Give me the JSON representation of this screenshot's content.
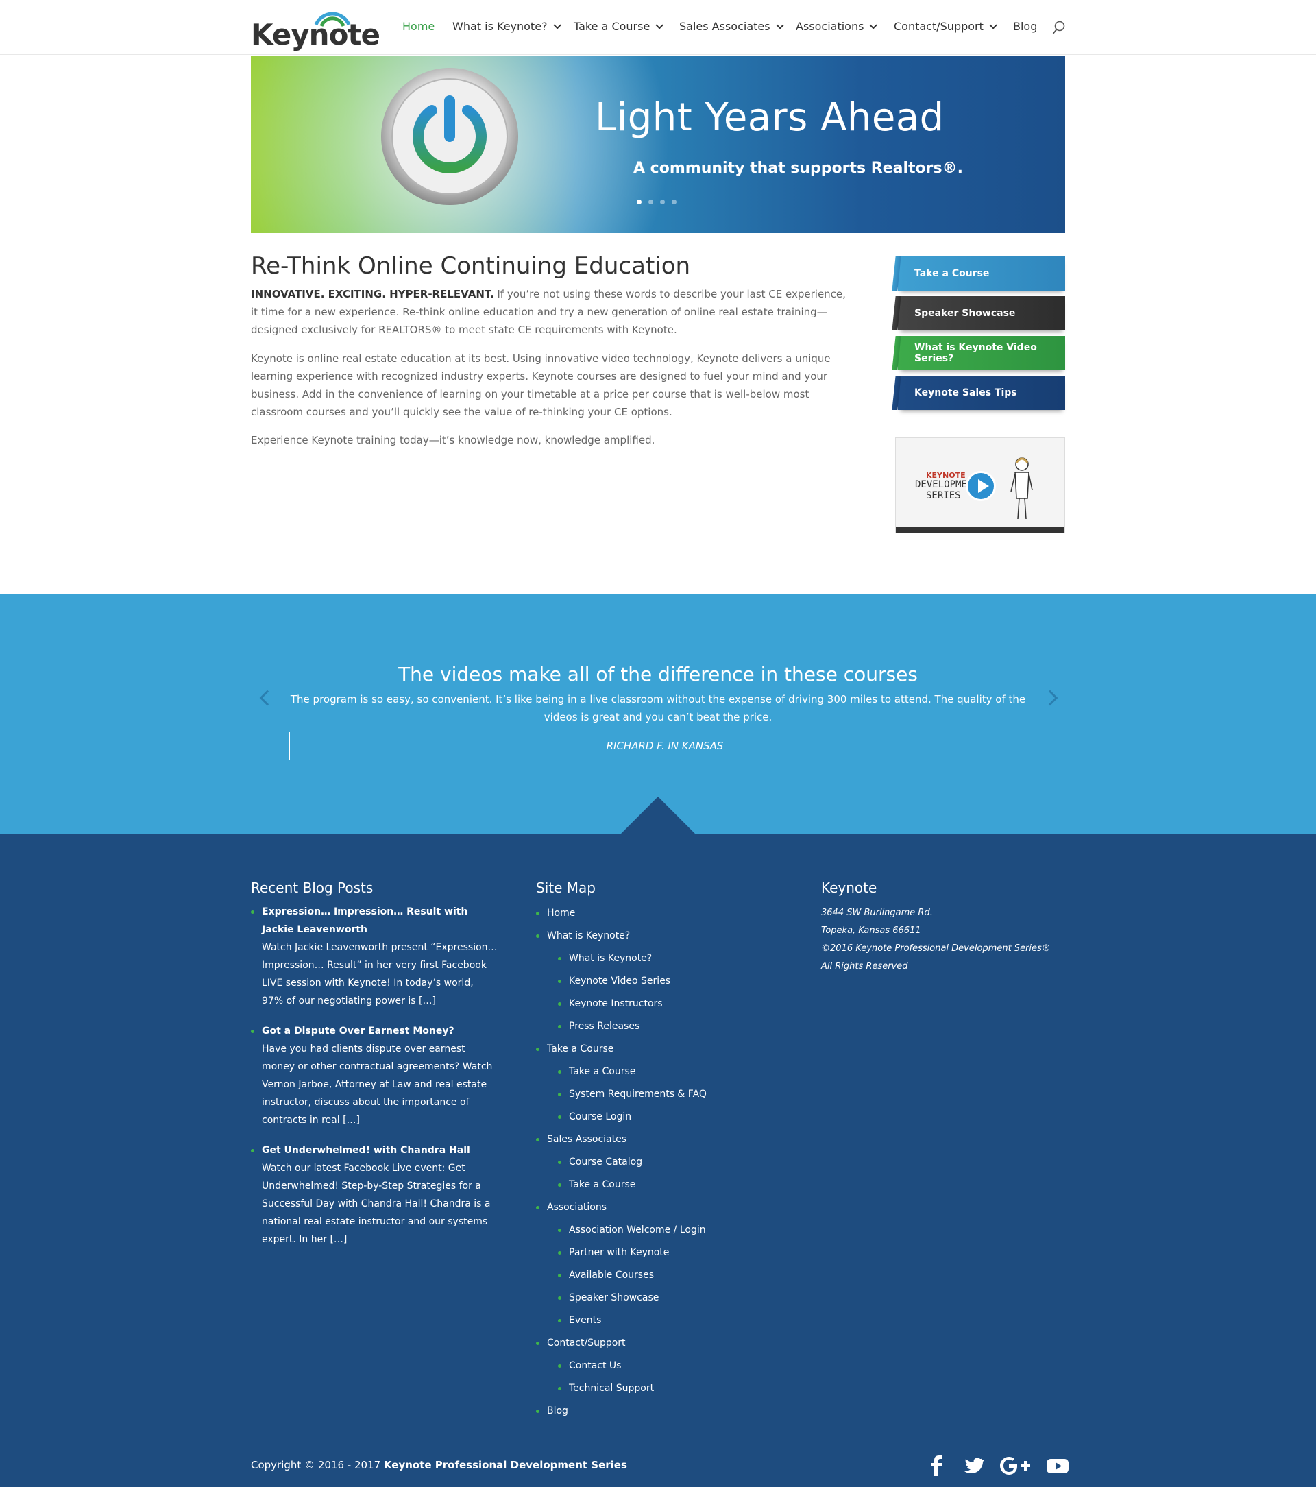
{
  "header": {
    "logo_text": "Keynote",
    "nav": [
      {
        "label": "Home",
        "active": true
      },
      {
        "label": "What is Keynote?",
        "dropdown": true
      },
      {
        "label": "Take a Course",
        "dropdown": true
      },
      {
        "label": "Sales Associates",
        "dropdown": true
      },
      {
        "label": "Associations",
        "dropdown": true
      },
      {
        "label": "Contact/Support",
        "dropdown": true
      },
      {
        "label": "Blog"
      }
    ],
    "search_icon": "search-icon"
  },
  "hero": {
    "title": "Light Years Ahead",
    "subtitle": "A community that supports Realtors®.",
    "slide_count": 4,
    "active_slide": 1
  },
  "main": {
    "title": "Re-Think Online Continuing Education",
    "intro_bold": "INNOVATIVE. EXCITING. HYPER-RELEVANT.",
    "intro_rest": " If you’re not using these words to describe your last CE experience, it time for a new experience. Re-think online education and try a new generation of online real estate training—designed exclusively for REALTORS® to meet state CE requirements with Keynote.",
    "para2": "Keynote is online real estate education at its best. Using innovative video technology, Keynote delivers a unique learning experience with recognized industry experts. Keynote courses are designed to fuel your mind and your business. Add in the convenience of learning on your timetable at a price per course that is well-below most classroom courses and you’ll quickly see the value of re-thinking your CE options.",
    "para3": "Experience Keynote training today—it’s knowledge now, knowledge amplified."
  },
  "sidebar": {
    "buttons": [
      {
        "label": "Take a Course",
        "color": "#3fa0d2"
      },
      {
        "label": "Speaker Showcase",
        "color": "#333333"
      },
      {
        "label": "What is Keynote Video Series?",
        "color": "#3dab4a"
      },
      {
        "label": "Keynote Sales Tips",
        "color": "#1f4c86"
      }
    ],
    "video": {
      "logo_line1": "KEYNOTE",
      "logo_line2": "DEVELOPME",
      "logo_line3": "SERIES"
    }
  },
  "testimonial": {
    "title": "The videos make all of the difference in these courses",
    "body": "The program is so easy, so convenient. It’s like being in a live classroom without the expense of driving 300 miles to attend. The quality of the videos is great and you can’t beat the price.",
    "author": "RICHARD F. IN KANSAS"
  },
  "footer": {
    "blog": {
      "title": "Recent Blog Posts",
      "posts": [
        {
          "title": "Expression… Impression… Result with Jackie Leavenworth",
          "excerpt": "Watch Jackie Leavenworth present “Expression… Impression… Result” in her very first Facebook LIVE session with Keynote! In today’s world, 97% of our negotiating power is […]"
        },
        {
          "title": "Got a Dispute Over Earnest Money?",
          "excerpt": "Have you had clients dispute over earnest money or other contractual agreements? Watch Vernon Jarboe, Attorney at Law and real estate instructor, discuss about the importance of contracts in real […]"
        },
        {
          "title": "Get Underwhelmed! with Chandra Hall",
          "excerpt": "Watch our latest Facebook Live event: Get Underwhelmed! Step-by-Step Strategies for a Successful Day with Chandra Hall! Chandra is a national real estate instructor and our systems expert. In her […]"
        }
      ]
    },
    "sitemap": {
      "title": "Site Map",
      "items": [
        {
          "label": "Home",
          "level": 0
        },
        {
          "label": "What is Keynote?",
          "level": 0
        },
        {
          "label": "What is Keynote?",
          "level": 1
        },
        {
          "label": "Keynote Video Series",
          "level": 1
        },
        {
          "label": "Keynote Instructors",
          "level": 1
        },
        {
          "label": "Press Releases",
          "level": 1
        },
        {
          "label": "Take a Course",
          "level": 0
        },
        {
          "label": "Take a Course",
          "level": 1
        },
        {
          "label": "System Requirements & FAQ",
          "level": 1
        },
        {
          "label": "Course Login",
          "level": 1
        },
        {
          "label": "Sales Associates",
          "level": 0
        },
        {
          "label": "Course Catalog",
          "level": 1
        },
        {
          "label": "Take a Course",
          "level": 1
        },
        {
          "label": "Associations",
          "level": 0
        },
        {
          "label": "Association Welcome / Login",
          "level": 1
        },
        {
          "label": "Partner with Keynote",
          "level": 1
        },
        {
          "label": "Available Courses",
          "level": 1
        },
        {
          "label": "Speaker Showcase",
          "level": 1
        },
        {
          "label": "Events",
          "level": 1
        },
        {
          "label": "Contact/Support",
          "level": 0
        },
        {
          "label": "Contact Us",
          "level": 1
        },
        {
          "label": "Technical Support",
          "level": 1
        },
        {
          "label": "Blog",
          "level": 0
        }
      ]
    },
    "company": {
      "title": "Keynote",
      "lines": [
        "3644 SW Burlingame Rd.",
        "Topeka, Kansas 66611",
        "©2016 Keynote Professional Development Series®",
        "All Rights Reserved"
      ]
    },
    "copyright_prefix": "Copyright © 2016 - 2017 ",
    "copyright_bold": "Keynote Professional Development Series",
    "social": [
      "facebook-icon",
      "twitter-icon",
      "google-plus-icon",
      "youtube-icon"
    ]
  },
  "colors": {
    "brand_green": "#3aa14a",
    "testimonial_bg": "#3ba3d5",
    "footer_bg": "#1e4c7f",
    "bullet_green": "#3fb54a"
  }
}
